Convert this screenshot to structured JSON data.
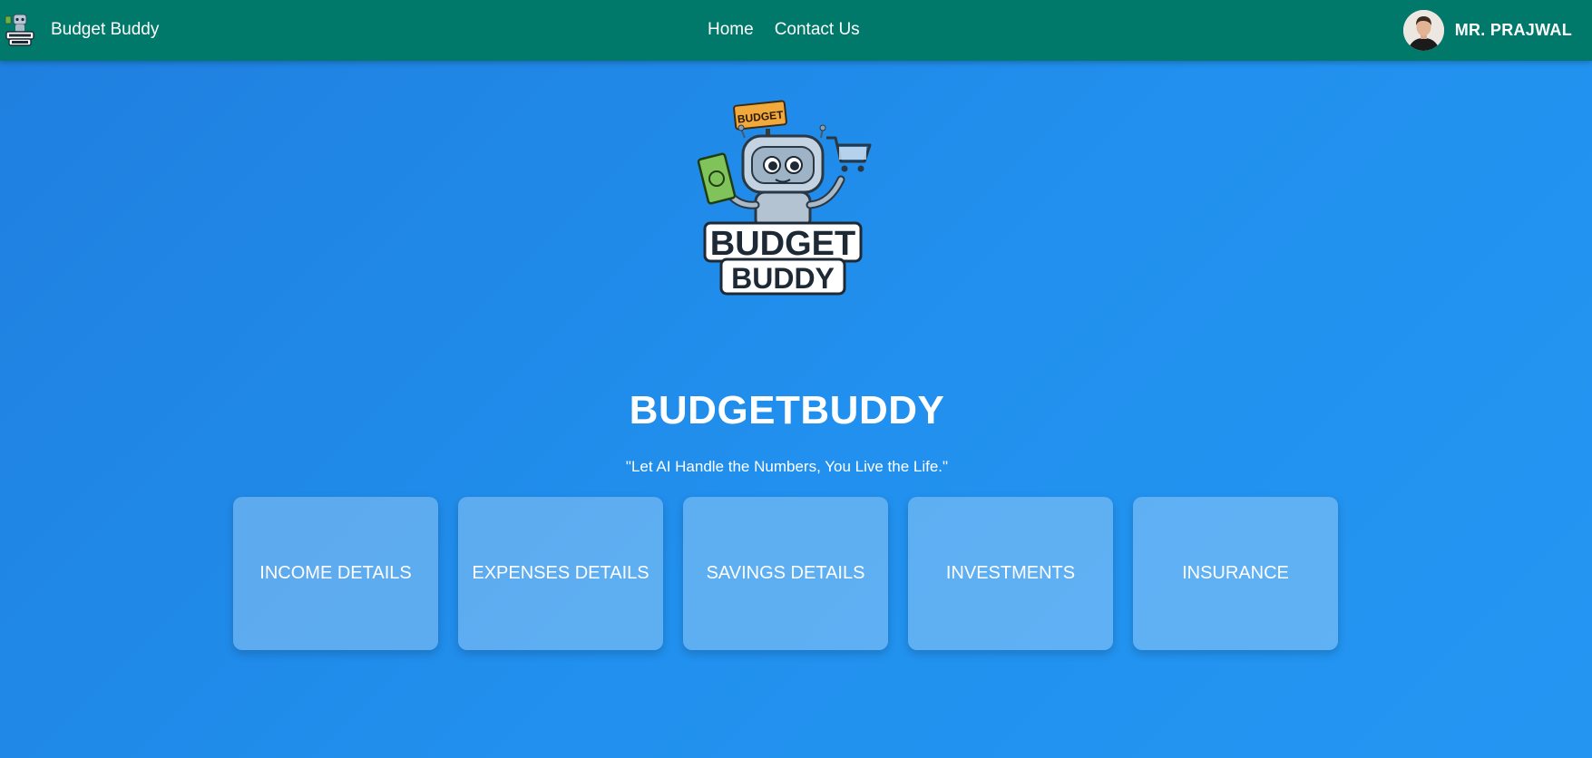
{
  "navbar": {
    "brand": "Budget Buddy",
    "logo_icon": "budget-buddy-robot-icon",
    "links": [
      {
        "label": "Home"
      },
      {
        "label": "Contact Us"
      }
    ],
    "user": {
      "name": "MR. PRAJWAL",
      "avatar_icon": "user-avatar"
    },
    "background": "#00796b"
  },
  "hero": {
    "logo_text_line1": "BUDGET",
    "logo_text_line2": "BUDDY",
    "logo_sign_text": "BUDGET",
    "title": "BUDGETBUDDY",
    "tagline": "\"Let AI Handle the Numbers, You Live the Life.\""
  },
  "cards": [
    {
      "label": "INCOME DETAILS"
    },
    {
      "label": "EXPENSES DETAILS"
    },
    {
      "label": "SAVINGS DETAILS"
    },
    {
      "label": "INVESTMENTS"
    },
    {
      "label": "INSURANCE"
    }
  ],
  "colors": {
    "background_start": "#1f7fdf",
    "background_end": "#2496f2",
    "card_fill": "rgba(255,255,255,0.28)"
  }
}
